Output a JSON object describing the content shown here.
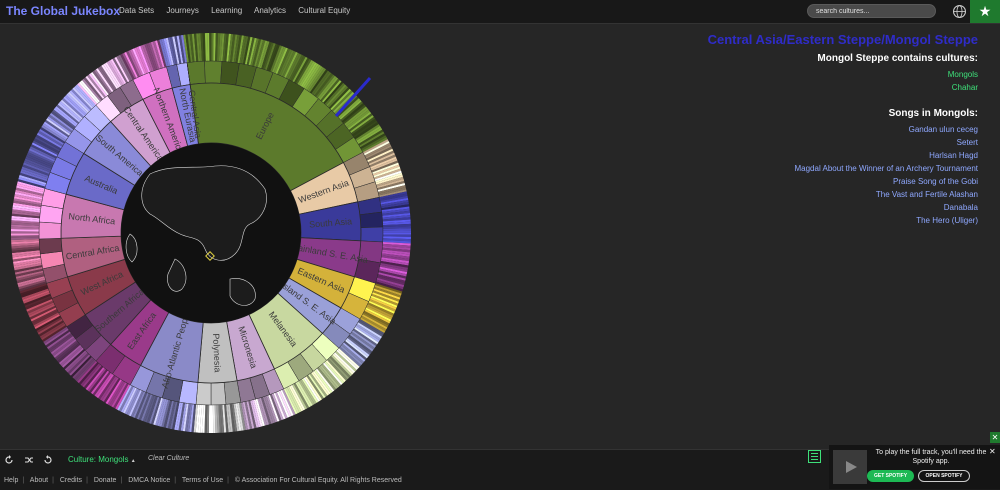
{
  "header": {
    "brand": "The Global Jukebox",
    "nav": [
      "Data Sets",
      "Journeys",
      "Learning",
      "Analytics",
      "Cultural Equity"
    ],
    "search_placeholder": "search cultures...",
    "globe_icon": "globe-icon",
    "star_icon": "star-icon"
  },
  "wheel": {
    "regions": [
      {
        "label": "Europe",
        "color": "#5c7a2c"
      },
      {
        "label": "Western Asia",
        "color": "#e8caa6"
      },
      {
        "label": "South Asia",
        "color": "#3a3a9a"
      },
      {
        "label": "Mainland S. E. Asia",
        "color": "#8a3a8a"
      },
      {
        "label": "Eastern Asia",
        "color": "#d4b23a"
      },
      {
        "label": "Island S. E. Asia",
        "color": "#9aa0d8"
      },
      {
        "label": "Melanesia",
        "color": "#c8d8a0"
      },
      {
        "label": "Micronesia",
        "color": "#c8a8d0"
      },
      {
        "label": "Polynesia",
        "color": "#c0c0c0"
      },
      {
        "label": "Afro-Atlantic Peoples",
        "color": "#8a8ac8"
      },
      {
        "label": "East Africa",
        "color": "#9a3a8a"
      },
      {
        "label": "Southern Africa",
        "color": "#6a3a6a"
      },
      {
        "label": "West Africa",
        "color": "#8a3a4a"
      },
      {
        "label": "Central Africa",
        "color": "#b06080"
      },
      {
        "label": "North Africa",
        "color": "#c878b0"
      },
      {
        "label": "Australia",
        "color": "#6a6ac8"
      },
      {
        "label": "South America",
        "color": "#8a8ad8"
      },
      {
        "label": "Central America",
        "color": "#d0a0d0"
      },
      {
        "label": "Northern America",
        "color": "#d070c0"
      },
      {
        "label": "North Eurasia",
        "color": "#8080e0"
      },
      {
        "label": "Central Asia",
        "color": "#5050d0"
      }
    ],
    "selected_marker_icon": "diamond-marker-icon"
  },
  "panel": {
    "region_path": "Central Asia/Eastern Steppe/Mongol Steppe",
    "contains_heading": "Mongol Steppe contains cultures:",
    "cultures": [
      "Mongols",
      "Chahar"
    ],
    "songs_heading": "Songs in Mongols:",
    "songs": [
      "Gandan ulun ceceg",
      "Setert",
      "Harlsan Hagd",
      "Magdal About the Winner of an Archery Tournament",
      "Praise Song of the Gobi",
      "The Vast and Fertile Alashan",
      "Danabala",
      "The Hero (Uliger)"
    ]
  },
  "bottom": {
    "refresh_icon": "refresh-icon",
    "shuffle_icon": "shuffle-icon",
    "reload_icon": "reload-icon",
    "culture_label": "Culture: Mongols",
    "caret": "▲",
    "clear_label": "Clear Culture",
    "footer_links": [
      "Help",
      "About",
      "Credits",
      "Donate",
      "DMCA Notice",
      "Terms of Use"
    ],
    "copyright": "© Association For Cultural Equity. All Rights Reserved"
  },
  "spotify": {
    "message": "To play the full track, you'll need the Spotify app.",
    "get_label": "GET SPOTIFY",
    "open_label": "OPEN SPOTIFY",
    "close": "✕"
  },
  "colors": {
    "brand": "#7b86ff",
    "accent_green": "#3ee07a",
    "region_title": "#2f2cc8",
    "song_link": "#8fa8ff"
  }
}
